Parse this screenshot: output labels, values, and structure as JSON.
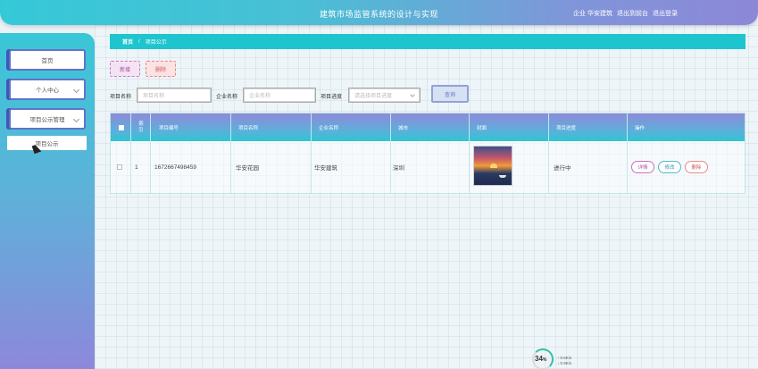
{
  "header": {
    "title": "建筑市场监管系统的设计与实现",
    "company": "企业 华安建筑",
    "exit_console": "退出到前台",
    "logout": "退出登录"
  },
  "sidebar": {
    "items": [
      {
        "label": "首页"
      },
      {
        "label": "个人中心"
      },
      {
        "label": "项目公示管理"
      }
    ],
    "sub_items": [
      {
        "label": "项目公示"
      }
    ]
  },
  "breadcrumb": {
    "home": "首页",
    "separator": "/",
    "current": "项目公示"
  },
  "actions": {
    "add": "新增",
    "delete": "删除"
  },
  "search": {
    "project_name_label": "项目名称",
    "project_name_placeholder": "项目名称",
    "company_name_label": "企业名称",
    "company_name_placeholder": "企业名称",
    "progress_label": "项目进度",
    "progress_placeholder": "请选择项目进度",
    "query_button": "查询"
  },
  "table": {
    "headers": [
      "索引",
      "项目编号",
      "项目名称",
      "企业名称",
      "城市",
      "封面",
      "项目进度",
      "操作"
    ],
    "rows": [
      {
        "index": "1",
        "project_no": "1672667498459",
        "project_name": "华安花园",
        "company_name": "华安建筑",
        "city": "深圳",
        "cover": "sunset-boat-image",
        "progress": "进行中",
        "ops": {
          "detail": "详情",
          "edit": "修改",
          "delete": "删除"
        }
      }
    ]
  },
  "widget": {
    "percent": "34",
    "percent_unit": "%",
    "upload": "0.5K/s",
    "download": "0.9K/s"
  },
  "colors": {
    "accent_cyan": "#1ec5cf",
    "accent_purple": "#8d87d8",
    "button_add": "#a64fa3",
    "button_delete": "#d45a5a"
  }
}
